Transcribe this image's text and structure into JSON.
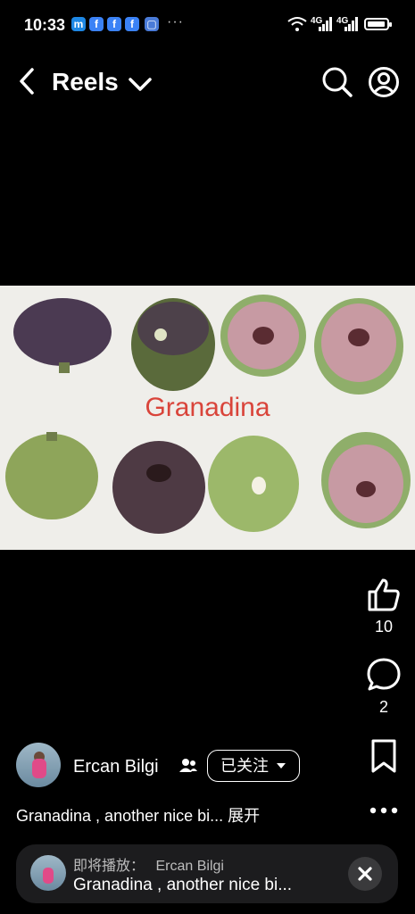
{
  "status_bar": {
    "time": "10:33",
    "notifications": [
      "messenger-icon",
      "facebook-icon",
      "facebook-icon",
      "facebook-icon",
      "gallery-icon"
    ],
    "more": "···",
    "network_1": "4G",
    "network_2": "4G"
  },
  "header": {
    "title": "Reels"
  },
  "media": {
    "caption_in_image": "Granadina"
  },
  "actions": {
    "likes": "10",
    "comments": "2"
  },
  "author": {
    "name": "Ercan Bilgi",
    "follow_label": "已关注"
  },
  "post": {
    "caption": "Granadina , another nice bi...",
    "expand_label": "展开"
  },
  "up_next": {
    "prefix": "即将播放：",
    "author": "Ercan Bilgi",
    "title": "Granadina , another nice bi..."
  },
  "colors": {
    "background": "#000000",
    "caption_red": "#d9443a",
    "follow_border": "#ffffff"
  }
}
